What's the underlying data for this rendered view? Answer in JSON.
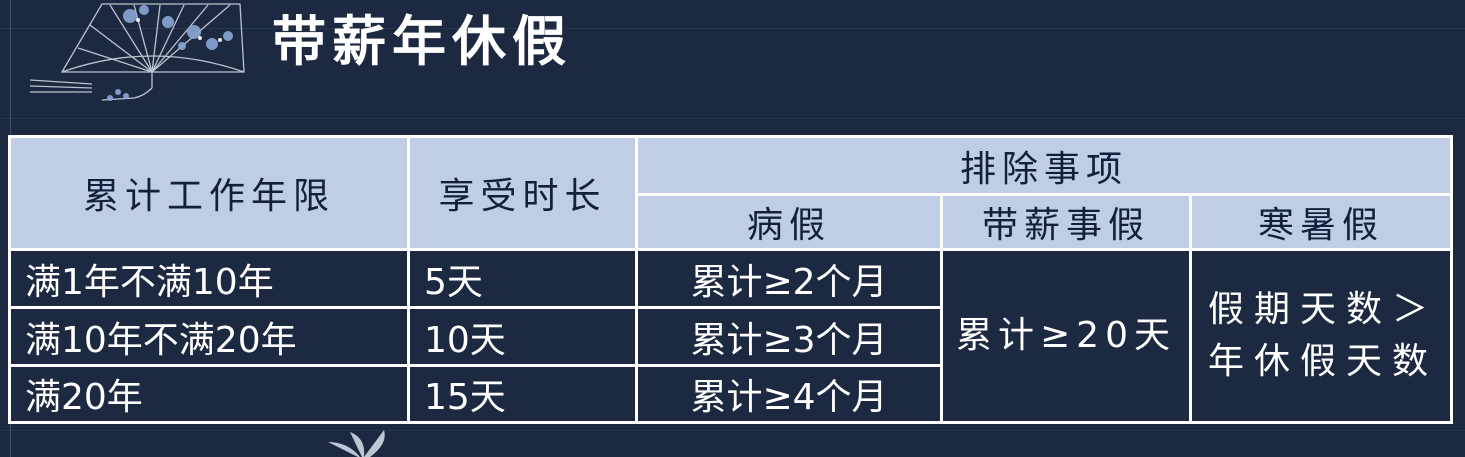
{
  "page": {
    "title": "带薪年休假"
  },
  "table": {
    "headers": {
      "cumulative_years": "累计工作年限",
      "entitlement": "享受时长",
      "exclusions": "排除事项",
      "sick_leave": "病假",
      "paid_personal_leave": "带薪事假",
      "school_holidays": "寒暑假"
    },
    "rows": [
      {
        "years": "满1年不满10年",
        "days": "5天",
        "sick": "累计≥2个月"
      },
      {
        "years": "满10年不满20年",
        "days": "10天",
        "sick": "累计≥3个月"
      },
      {
        "years": "满20年",
        "days": "15天",
        "sick": "累计≥4个月"
      }
    ],
    "personal_leave_rule": "累计≥20天",
    "holiday_rule": "假期天数＞年休假天数"
  },
  "colors": {
    "background": "#1c2940",
    "header_fill": "#c0cde4",
    "header_text": "#14203a",
    "border": "#ffffff",
    "body_text": "#ffffff"
  },
  "icons": {
    "top_left": "fan-with-flowers-icon",
    "bottom": "butterfly-icon"
  }
}
